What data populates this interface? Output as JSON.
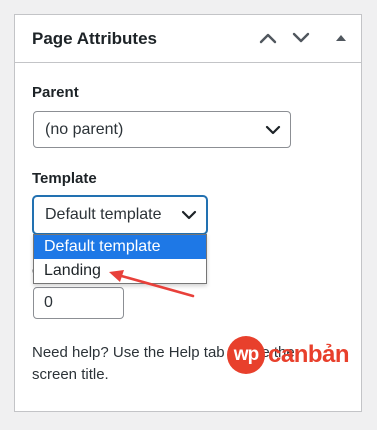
{
  "panel": {
    "title": "Page Attributes"
  },
  "header_buttons": {
    "move_up_icon": "chevron-up-icon",
    "move_down_icon": "chevron-down-icon",
    "toggle_icon": "triangle-up-icon"
  },
  "parent": {
    "label": "Parent",
    "selected": "(no parent)"
  },
  "template": {
    "label": "Template",
    "selected": "Default template",
    "options": [
      "Default template",
      "Landing"
    ],
    "highlighted_option": "Default template"
  },
  "order": {
    "label_fragment": "O",
    "value": "0"
  },
  "help": {
    "text": "Need help? Use the Help tab above the screen title."
  },
  "annotation": {
    "arrow_color": "#e8403a"
  },
  "watermark": {
    "badge": "wp",
    "text": "canbản"
  },
  "colors": {
    "accent": "#2271b1",
    "highlight": "#1e78e6",
    "brand": "#e8402c"
  }
}
